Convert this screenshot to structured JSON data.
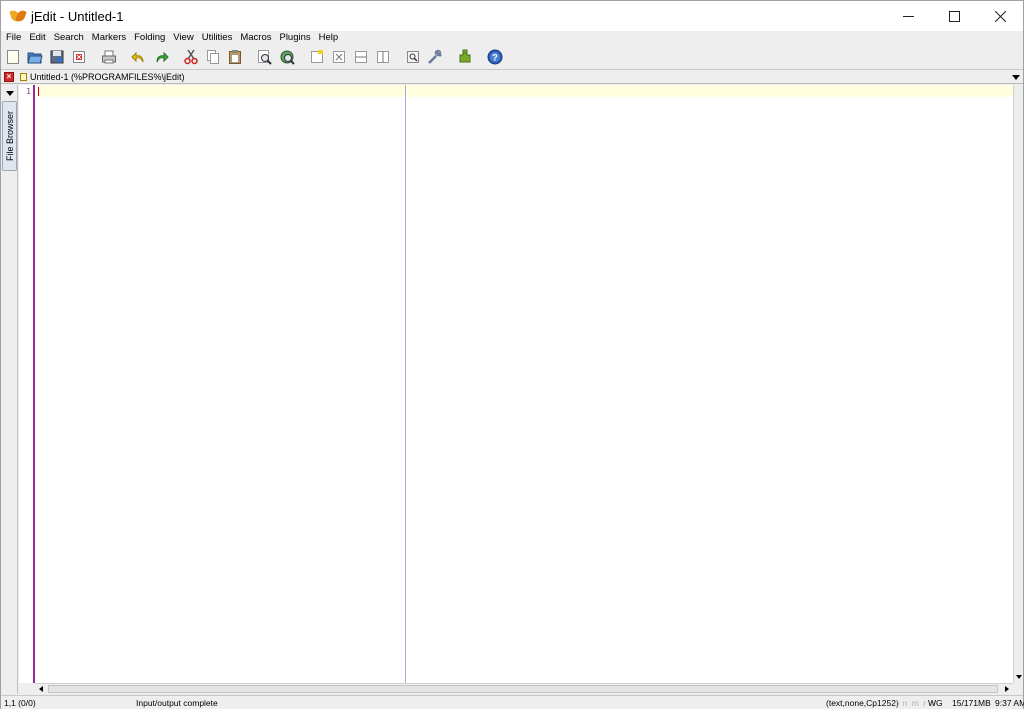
{
  "window": {
    "title": "jEdit - Untitled-1",
    "controls": {
      "minimize": "minimize-icon",
      "maximize": "maximize-icon",
      "close": "close-icon"
    }
  },
  "menu": {
    "items": [
      "File",
      "Edit",
      "Search",
      "Markers",
      "Folding",
      "View",
      "Utilities",
      "Macros",
      "Plugins",
      "Help"
    ]
  },
  "toolbar": {
    "icons": [
      "new-file-icon",
      "open-file-icon",
      "save-file-icon",
      "close-file-icon",
      "print-icon",
      "undo-icon",
      "redo-icon",
      "cut-icon",
      "copy-icon",
      "paste-icon",
      "find-icon",
      "find-in-files-icon",
      "new-view-icon",
      "unsplit-icon",
      "split-horizontal-icon",
      "split-vertical-icon",
      "buffer-options-icon",
      "global-options-icon",
      "plugin-manager-icon",
      "help-icon"
    ]
  },
  "buffer_tabs": {
    "active_label": "Untitled-1 (%PROGRAMFILES%\\jEdit)"
  },
  "dock": {
    "left_tab": "File Browser"
  },
  "editor": {
    "line_number": "1"
  },
  "status": {
    "caret": "1,1 (0/0)",
    "message": "Input/output complete",
    "mode": "(text,none,Cp1252)",
    "flags": "I n m r o",
    "wrap": "WG",
    "memory": "15/171MB",
    "clock": "9:37 AM"
  },
  "colors": {
    "gutter_border": "#9b2a9b",
    "current_line": "#ffffe0",
    "wrap_guide": "#a8a8e0",
    "caret": "#cc0000"
  }
}
